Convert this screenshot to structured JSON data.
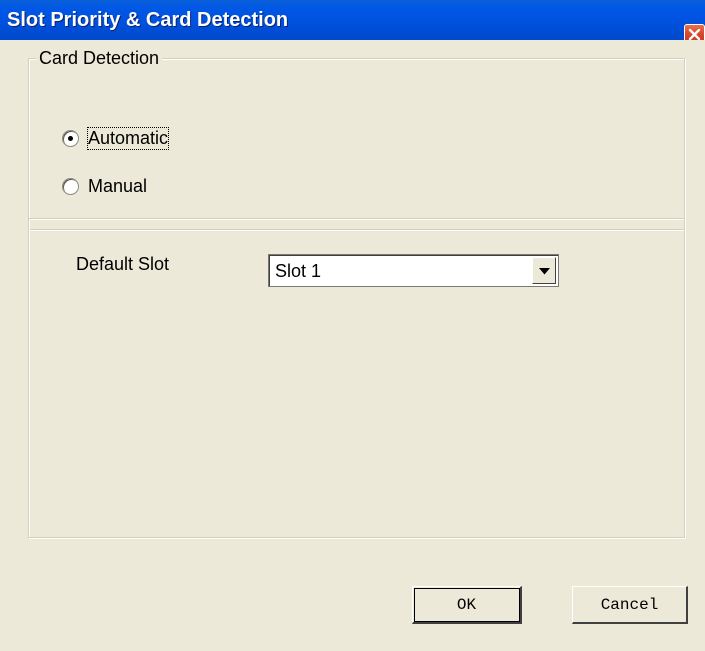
{
  "window": {
    "title": "Slot Priority & Card Detection"
  },
  "card_detection": {
    "legend": "Card Detection",
    "options": [
      {
        "label": "Automatic",
        "selected": true
      },
      {
        "label": "Manual",
        "selected": false
      }
    ]
  },
  "default_slot": {
    "label": "Default Slot",
    "selected_value": "Slot 1"
  },
  "buttons": {
    "ok_label": "OK",
    "cancel_label": "Cancel"
  },
  "icons": {
    "close": "close-icon",
    "dropdown": "chevron-down-icon"
  },
  "colors": {
    "titlebar": "#0054e3",
    "dialog_bg": "#ece9d8",
    "close_button": "#d9462a"
  }
}
